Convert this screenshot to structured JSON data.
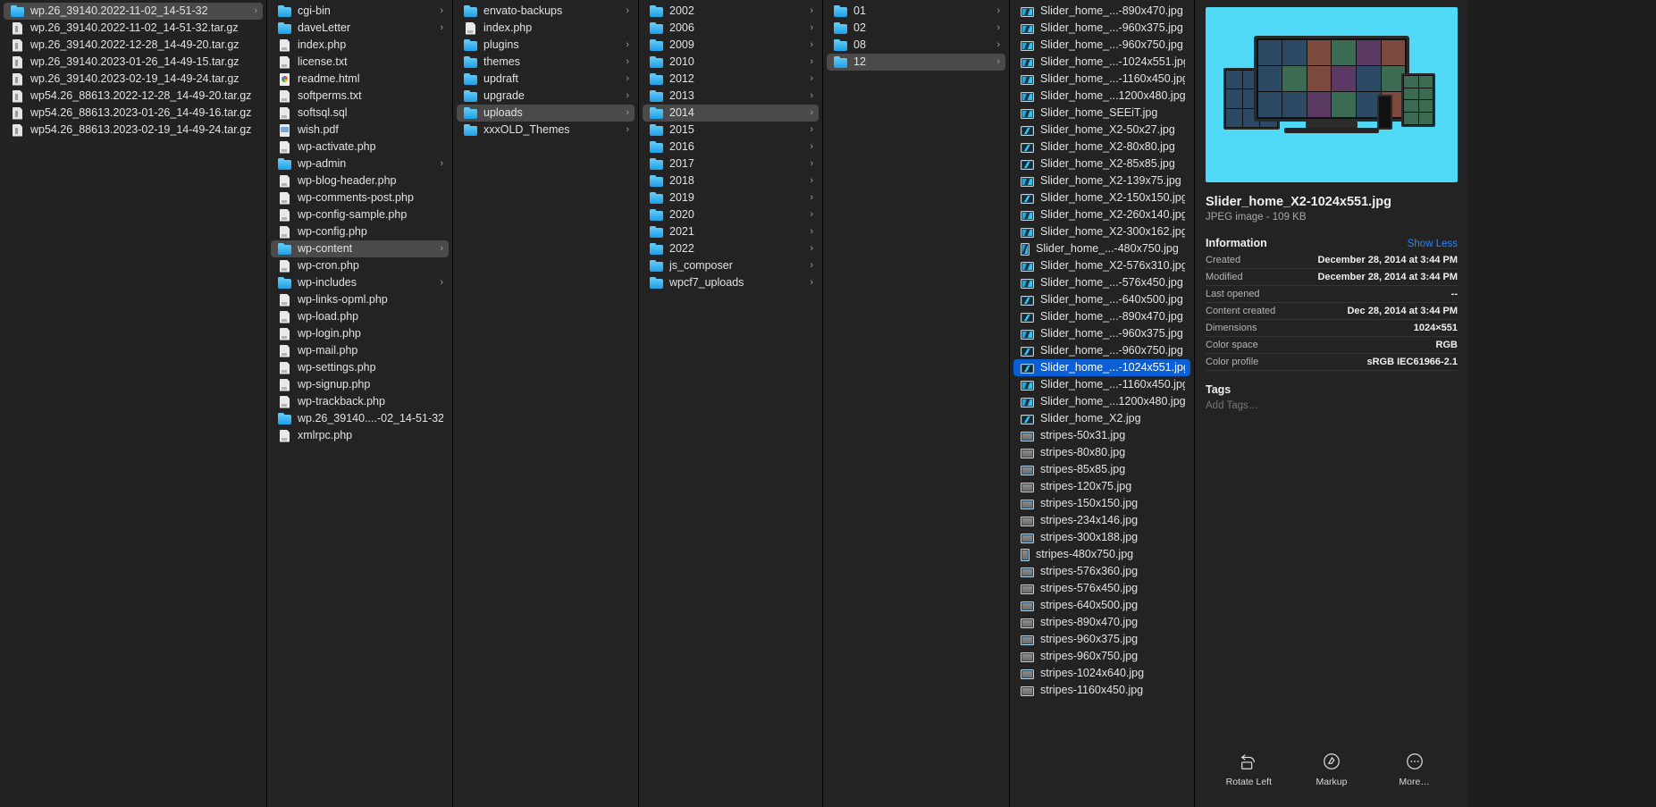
{
  "app": "finder-column-view",
  "colors": {
    "selection_active": "#0a5fd4",
    "selection_inactive": "#4a4a4a",
    "accent_link": "#2f84ef",
    "background": "#232323",
    "folder_blue": "#1f9fe8"
  },
  "columns": [
    {
      "name": "backups-column",
      "items": [
        {
          "label": "wp.26_39140.2022-11-02_14-51-32",
          "icon": "folder-icon",
          "type": "folder",
          "state": "selected-inactive",
          "chevron": true
        },
        {
          "label": "wp.26_39140.2022-11-02_14-51-32.tar.gz",
          "icon": "archive-icon",
          "type": "archive"
        },
        {
          "label": "wp.26_39140.2022-12-28_14-49-20.tar.gz",
          "icon": "archive-icon",
          "type": "archive"
        },
        {
          "label": "wp.26_39140.2023-01-26_14-49-15.tar.gz",
          "icon": "archive-icon",
          "type": "archive"
        },
        {
          "label": "wp.26_39140.2023-02-19_14-49-24.tar.gz",
          "icon": "archive-icon",
          "type": "archive"
        },
        {
          "label": "wp54.26_88613.2022-12-28_14-49-20.tar.gz",
          "icon": "archive-icon",
          "type": "archive"
        },
        {
          "label": "wp54.26_88613.2023-01-26_14-49-16.tar.gz",
          "icon": "archive-icon",
          "type": "archive"
        },
        {
          "label": "wp54.26_88613.2023-02-19_14-49-24.tar.gz",
          "icon": "archive-icon",
          "type": "archive"
        }
      ]
    },
    {
      "name": "wordpress-root-column",
      "items": [
        {
          "label": "cgi-bin",
          "icon": "folder-icon",
          "type": "folder",
          "chevron": true
        },
        {
          "label": "daveLetter",
          "icon": "folder-icon",
          "type": "folder",
          "chevron": true
        },
        {
          "label": "index.php",
          "icon": "document-icon",
          "type": "doc"
        },
        {
          "label": "license.txt",
          "icon": "document-icon",
          "type": "doc"
        },
        {
          "label": "readme.html",
          "icon": "html-document-icon",
          "type": "html"
        },
        {
          "label": "softperms.txt",
          "icon": "document-icon",
          "type": "doc"
        },
        {
          "label": "softsql.sql",
          "icon": "document-icon",
          "type": "doc"
        },
        {
          "label": "wish.pdf",
          "icon": "pdf-document-icon",
          "type": "pdf"
        },
        {
          "label": "wp-activate.php",
          "icon": "document-icon",
          "type": "doc"
        },
        {
          "label": "wp-admin",
          "icon": "folder-icon",
          "type": "folder",
          "chevron": true
        },
        {
          "label": "wp-blog-header.php",
          "icon": "document-icon",
          "type": "doc"
        },
        {
          "label": "wp-comments-post.php",
          "icon": "document-icon",
          "type": "doc"
        },
        {
          "label": "wp-config-sample.php",
          "icon": "document-icon",
          "type": "doc"
        },
        {
          "label": "wp-config.php",
          "icon": "document-icon",
          "type": "doc"
        },
        {
          "label": "wp-content",
          "icon": "folder-icon",
          "type": "folder",
          "state": "selected-inactive",
          "chevron": true
        },
        {
          "label": "wp-cron.php",
          "icon": "document-icon",
          "type": "doc"
        },
        {
          "label": "wp-includes",
          "icon": "folder-icon",
          "type": "folder",
          "chevron": true
        },
        {
          "label": "wp-links-opml.php",
          "icon": "document-icon",
          "type": "doc"
        },
        {
          "label": "wp-load.php",
          "icon": "document-icon",
          "type": "doc"
        },
        {
          "label": "wp-login.php",
          "icon": "document-icon",
          "type": "doc"
        },
        {
          "label": "wp-mail.php",
          "icon": "document-icon",
          "type": "doc"
        },
        {
          "label": "wp-settings.php",
          "icon": "document-icon",
          "type": "doc"
        },
        {
          "label": "wp-signup.php",
          "icon": "document-icon",
          "type": "doc"
        },
        {
          "label": "wp-trackback.php",
          "icon": "document-icon",
          "type": "doc"
        },
        {
          "label": "wp.26_39140....-02_14-51-32",
          "icon": "folder-icon",
          "type": "folder"
        },
        {
          "label": "xmlrpc.php",
          "icon": "document-icon",
          "type": "doc"
        }
      ]
    },
    {
      "name": "wp-content-column",
      "items": [
        {
          "label": "envato-backups",
          "icon": "folder-icon",
          "type": "folder",
          "chevron": true
        },
        {
          "label": "index.php",
          "icon": "document-icon",
          "type": "doc"
        },
        {
          "label": "plugins",
          "icon": "folder-icon",
          "type": "folder",
          "chevron": true
        },
        {
          "label": "themes",
          "icon": "folder-icon",
          "type": "folder",
          "chevron": true
        },
        {
          "label": "updraft",
          "icon": "folder-icon",
          "type": "folder",
          "chevron": true
        },
        {
          "label": "upgrade",
          "icon": "folder-icon",
          "type": "folder",
          "chevron": true
        },
        {
          "label": "uploads",
          "icon": "folder-icon",
          "type": "folder",
          "state": "selected-inactive",
          "chevron": true
        },
        {
          "label": "xxxOLD_Themes",
          "icon": "folder-icon",
          "type": "folder",
          "chevron": true
        }
      ]
    },
    {
      "name": "uploads-years-column",
      "items": [
        {
          "label": "2002",
          "icon": "folder-icon",
          "type": "folder",
          "chevron": true
        },
        {
          "label": "2006",
          "icon": "folder-icon",
          "type": "folder",
          "chevron": true
        },
        {
          "label": "2009",
          "icon": "folder-icon",
          "type": "folder",
          "chevron": true
        },
        {
          "label": "2010",
          "icon": "folder-icon",
          "type": "folder",
          "chevron": true
        },
        {
          "label": "2012",
          "icon": "folder-icon",
          "type": "folder",
          "chevron": true
        },
        {
          "label": "2013",
          "icon": "folder-icon",
          "type": "folder",
          "chevron": true
        },
        {
          "label": "2014",
          "icon": "folder-icon",
          "type": "folder",
          "state": "selected-inactive",
          "chevron": true
        },
        {
          "label": "2015",
          "icon": "folder-icon",
          "type": "folder",
          "chevron": true
        },
        {
          "label": "2016",
          "icon": "folder-icon",
          "type": "folder",
          "chevron": true
        },
        {
          "label": "2017",
          "icon": "folder-icon",
          "type": "folder",
          "chevron": true
        },
        {
          "label": "2018",
          "icon": "folder-icon",
          "type": "folder",
          "chevron": true
        },
        {
          "label": "2019",
          "icon": "folder-icon",
          "type": "folder",
          "chevron": true
        },
        {
          "label": "2020",
          "icon": "folder-icon",
          "type": "folder",
          "chevron": true
        },
        {
          "label": "2021",
          "icon": "folder-icon",
          "type": "folder",
          "chevron": true
        },
        {
          "label": "2022",
          "icon": "folder-icon",
          "type": "folder",
          "chevron": true
        },
        {
          "label": "js_composer",
          "icon": "folder-icon",
          "type": "folder",
          "chevron": true
        },
        {
          "label": "wpcf7_uploads",
          "icon": "folder-icon",
          "type": "folder",
          "chevron": true
        }
      ]
    },
    {
      "name": "months-column",
      "items": [
        {
          "label": "01",
          "icon": "folder-icon",
          "type": "folder",
          "chevron": true
        },
        {
          "label": "02",
          "icon": "folder-icon",
          "type": "folder",
          "chevron": true
        },
        {
          "label": "08",
          "icon": "folder-icon",
          "type": "folder",
          "chevron": true
        },
        {
          "label": "12",
          "icon": "folder-icon",
          "type": "folder",
          "state": "selected-inactive",
          "chevron": true
        }
      ]
    },
    {
      "name": "files-column",
      "items": [
        {
          "label": "Slider_home_...-890x470.jpg",
          "icon": "image-file-icon",
          "type": "img"
        },
        {
          "label": "Slider_home_...-960x375.jpg",
          "icon": "image-file-icon",
          "type": "img"
        },
        {
          "label": "Slider_home_...-960x750.jpg",
          "icon": "image-file-icon",
          "type": "img"
        },
        {
          "label": "Slider_home_...-1024x551.jpg",
          "icon": "image-file-icon",
          "type": "img"
        },
        {
          "label": "Slider_home_...-1160x450.jpg",
          "icon": "image-file-icon",
          "type": "img"
        },
        {
          "label": "Slider_home_...1200x480.jpg",
          "icon": "image-file-icon",
          "type": "img"
        },
        {
          "label": "Slider_home_SEEiT.jpg",
          "icon": "image-file-icon",
          "type": "img"
        },
        {
          "label": "Slider_home_X2-50x27.jpg",
          "icon": "image-file-icon",
          "type": "img-dark"
        },
        {
          "label": "Slider_home_X2-80x80.jpg",
          "icon": "image-file-icon",
          "type": "img-dark"
        },
        {
          "label": "Slider_home_X2-85x85.jpg",
          "icon": "image-file-icon",
          "type": "img-dark"
        },
        {
          "label": "Slider_home_X2-139x75.jpg",
          "icon": "image-file-icon",
          "type": "img"
        },
        {
          "label": "Slider_home_X2-150x150.jpg",
          "icon": "image-file-icon",
          "type": "img-dark"
        },
        {
          "label": "Slider_home_X2-260x140.jpg",
          "icon": "image-file-icon",
          "type": "img"
        },
        {
          "label": "Slider_home_X2-300x162.jpg",
          "icon": "image-file-icon",
          "type": "img"
        },
        {
          "label": "Slider_home_...-480x750.jpg",
          "icon": "image-file-icon",
          "type": "img-tall"
        },
        {
          "label": "Slider_home_X2-576x310.jpg",
          "icon": "image-file-icon",
          "type": "img"
        },
        {
          "label": "Slider_home_...-576x450.jpg",
          "icon": "image-file-icon",
          "type": "img"
        },
        {
          "label": "Slider_home_...-640x500.jpg",
          "icon": "image-file-icon",
          "type": "img-dark"
        },
        {
          "label": "Slider_home_...-890x470.jpg",
          "icon": "image-file-icon",
          "type": "img-dark"
        },
        {
          "label": "Slider_home_...-960x375.jpg",
          "icon": "image-file-icon",
          "type": "img"
        },
        {
          "label": "Slider_home_...-960x750.jpg",
          "icon": "image-file-icon",
          "type": "img-dark"
        },
        {
          "label": "Slider_home_...-1024x551.jpg",
          "icon": "image-file-icon",
          "type": "img-dark",
          "state": "selected-active"
        },
        {
          "label": "Slider_home_...-1160x450.jpg",
          "icon": "image-file-icon",
          "type": "img"
        },
        {
          "label": "Slider_home_...1200x480.jpg",
          "icon": "image-file-icon",
          "type": "img"
        },
        {
          "label": "Slider_home_X2.jpg",
          "icon": "image-file-icon",
          "type": "img-dark"
        },
        {
          "label": "stripes-50x31.jpg",
          "icon": "image-file-icon",
          "type": "img-grey"
        },
        {
          "label": "stripes-80x80.jpg",
          "icon": "image-file-icon",
          "type": "img-grey"
        },
        {
          "label": "stripes-85x85.jpg",
          "icon": "image-file-icon",
          "type": "img-grey"
        },
        {
          "label": "stripes-120x75.jpg",
          "icon": "image-file-icon",
          "type": "img-grey"
        },
        {
          "label": "stripes-150x150.jpg",
          "icon": "image-file-icon",
          "type": "img-grey"
        },
        {
          "label": "stripes-234x146.jpg",
          "icon": "image-file-icon",
          "type": "img-grey"
        },
        {
          "label": "stripes-300x188.jpg",
          "icon": "image-file-icon",
          "type": "img-grey"
        },
        {
          "label": "stripes-480x750.jpg",
          "icon": "image-file-icon",
          "type": "img-grey-tall"
        },
        {
          "label": "stripes-576x360.jpg",
          "icon": "image-file-icon",
          "type": "img-grey"
        },
        {
          "label": "stripes-576x450.jpg",
          "icon": "image-file-icon",
          "type": "img-grey"
        },
        {
          "label": "stripes-640x500.jpg",
          "icon": "image-file-icon",
          "type": "img-grey"
        },
        {
          "label": "stripes-890x470.jpg",
          "icon": "image-file-icon",
          "type": "img-grey"
        },
        {
          "label": "stripes-960x375.jpg",
          "icon": "image-file-icon",
          "type": "img-grey"
        },
        {
          "label": "stripes-960x750.jpg",
          "icon": "image-file-icon",
          "type": "img-grey"
        },
        {
          "label": "stripes-1024x640.jpg",
          "icon": "image-file-icon",
          "type": "img-grey"
        },
        {
          "label": "stripes-1160x450.jpg",
          "icon": "image-file-icon",
          "type": "img-grey"
        }
      ]
    }
  ],
  "preview": {
    "title": "Slider_home_X2-1024x551.jpg",
    "subtitle": "JPEG image - 109 KB",
    "information_heading": "Information",
    "show_less_label": "Show Less",
    "rows": [
      {
        "key": "Created",
        "value": "December 28, 2014 at 3:44 PM"
      },
      {
        "key": "Modified",
        "value": "December 28, 2014 at 3:44 PM"
      },
      {
        "key": "Last opened",
        "value": "--"
      },
      {
        "key": "Content created",
        "value": "Dec 28, 2014 at 3:44 PM"
      },
      {
        "key": "Dimensions",
        "value": "1024×551"
      },
      {
        "key": "Color space",
        "value": "RGB"
      },
      {
        "key": "Color profile",
        "value": "sRGB IEC61966-2.1"
      }
    ],
    "tags_heading": "Tags",
    "tags_placeholder": "Add Tags…",
    "actions": [
      {
        "label": "Rotate Left",
        "icon": "rotate-left-icon"
      },
      {
        "label": "Markup",
        "icon": "markup-icon"
      },
      {
        "label": "More…",
        "icon": "more-icon"
      }
    ]
  }
}
